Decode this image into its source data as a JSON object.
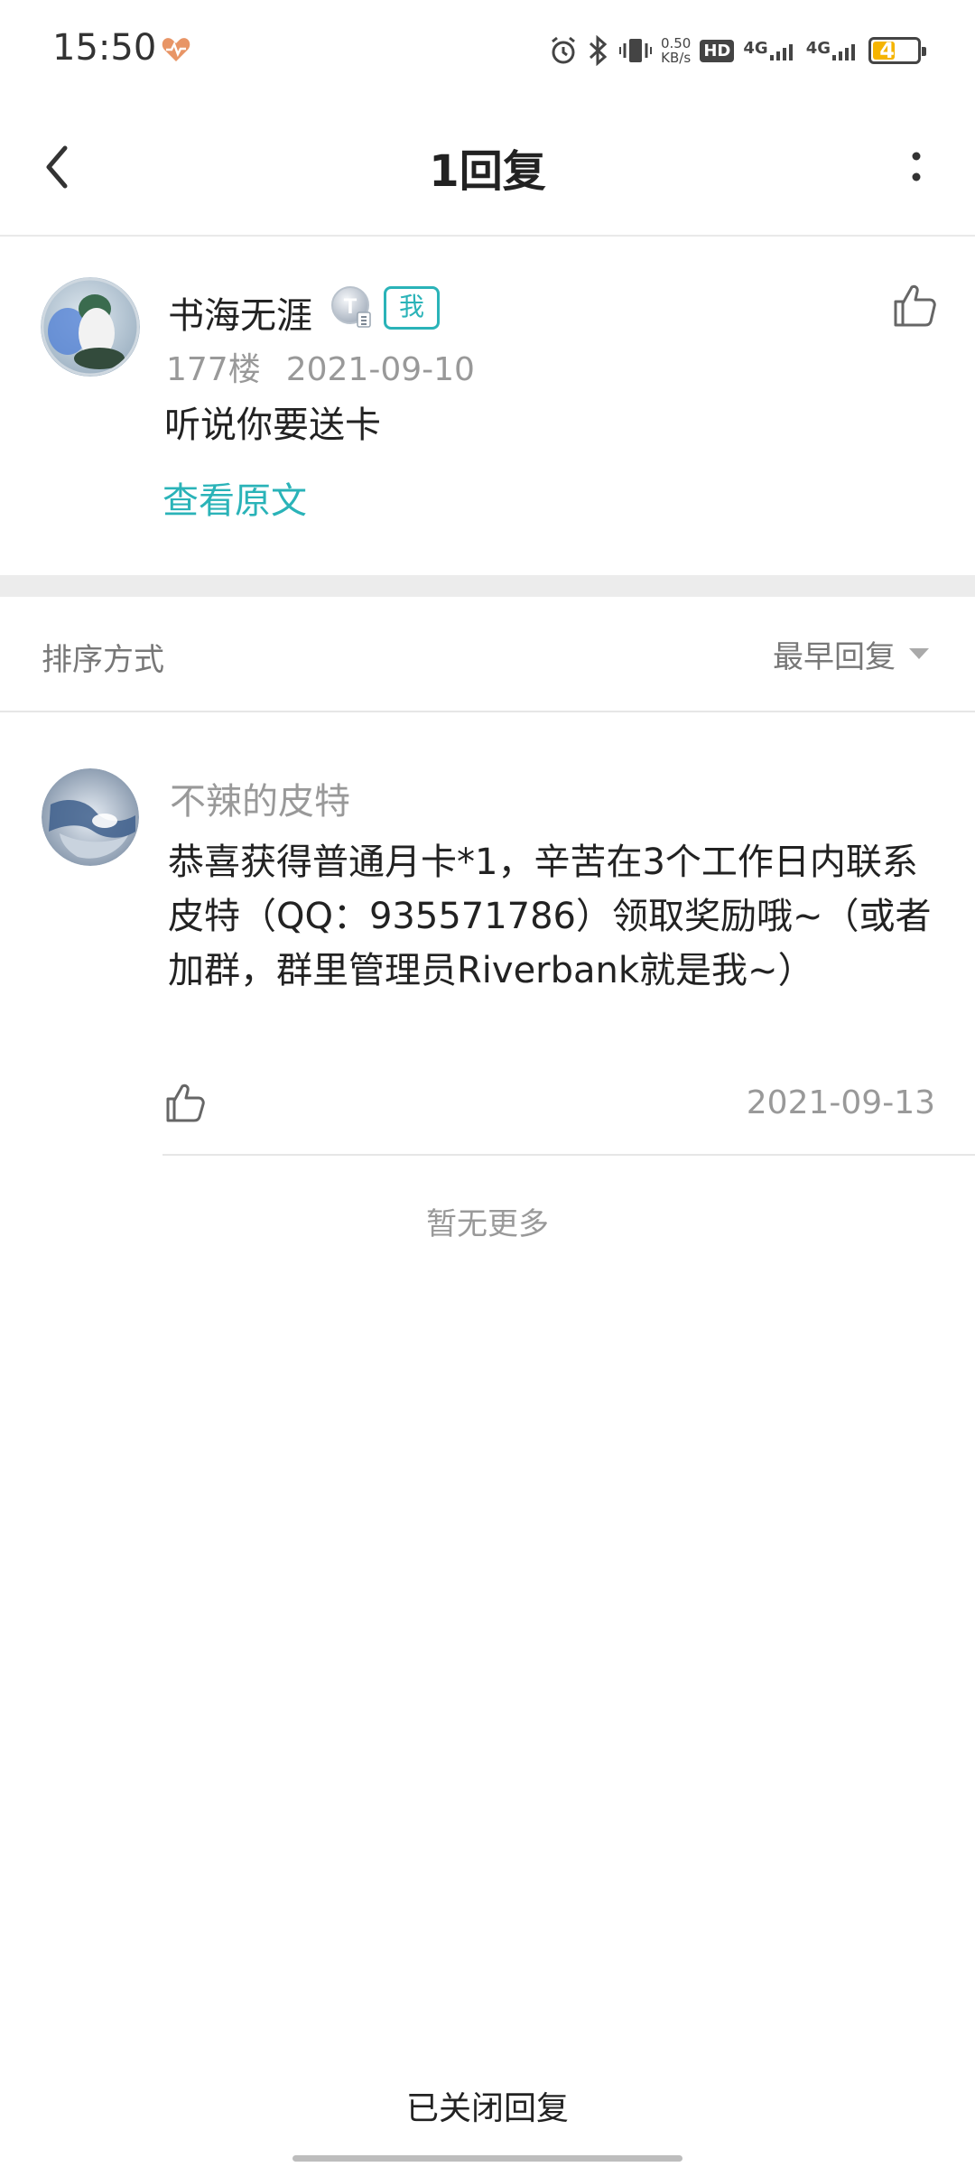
{
  "status_bar": {
    "time": "15:50",
    "net_speed_value": "0.50",
    "net_speed_unit": "KB/s",
    "hd_label": "HD",
    "signal_1": "4G",
    "signal_2": "4G",
    "battery_percent": "49",
    "battery_level": 0.49,
    "battery_color": "#f5b400"
  },
  "header": {
    "title": "1回复"
  },
  "original_post": {
    "author": "书海无涯",
    "level_badge": "T",
    "me_badge": "我",
    "floor": "177楼",
    "date": "2021-09-10",
    "content": "听说你要送卡",
    "view_original_label": "查看原文"
  },
  "sort": {
    "label": "排序方式",
    "value": "最早回复"
  },
  "reply": {
    "author": "不辣的皮特",
    "content": "恭喜获得普通月卡*1，辛苦在3个工作日内联系皮特（QQ：935571786）领取奖励哦~（或者加群，群里管理员Riverbank就是我~）",
    "date": "2021-09-13"
  },
  "no_more_text": "暂无更多",
  "footer": {
    "closed_text": "已关闭回复"
  },
  "colors": {
    "accent": "#2ab3b8",
    "muted_text": "#999999",
    "divider": "#e6e6e6"
  }
}
